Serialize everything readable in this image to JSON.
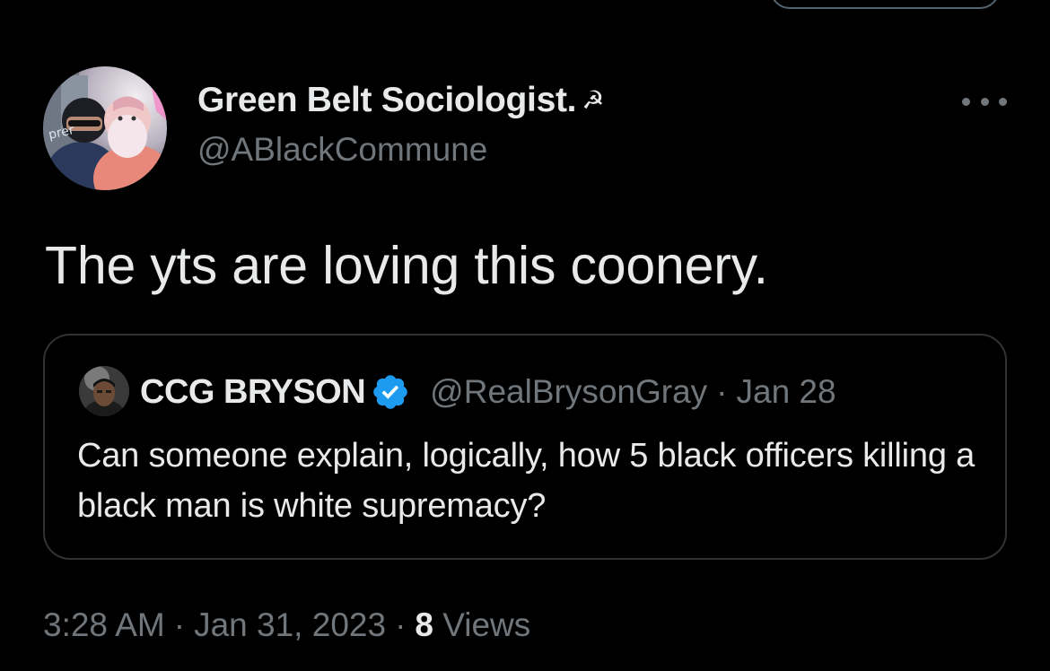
{
  "author": {
    "display_name": "Green Belt Sociologist.",
    "name_emoji": "☭",
    "handle": "@ABlackCommune"
  },
  "tweet": {
    "text": "The yts are loving this coonery."
  },
  "quoted_tweet": {
    "display_name": "CCG BRYSON",
    "verified": true,
    "handle": "@RealBrysonGray",
    "separator": "·",
    "date": "Jan 28",
    "text": "Can someone explain, logically, how 5 black officers killing a black man is white supremacy?"
  },
  "meta": {
    "time": "3:28 AM",
    "separator": "·",
    "date": "Jan 31, 2023",
    "separator2": "·",
    "views_count": "8",
    "views_label": "Views"
  },
  "colors": {
    "background": "#000000",
    "primary_text": "#e7e9ea",
    "secondary_text": "#71767b",
    "border": "#2f3336",
    "verified_blue": "#1d9bf0"
  },
  "icons": {
    "more": "more-horizontal-icon",
    "verified": "verified-badge-icon"
  }
}
